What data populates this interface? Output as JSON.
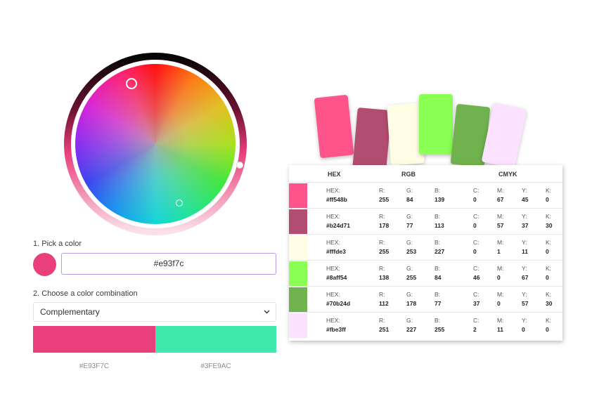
{
  "picker": {
    "step1_label": "1. Pick a color",
    "current_color": "#e93f7c",
    "hex_value": "#e93f7c",
    "step2_label": "2. Choose a color combination",
    "combination": "Complementary",
    "combo_colors": [
      "#E93F7C",
      "#3FE9AC"
    ],
    "combo_labels": [
      "#E93F7C",
      "#3FE9AC"
    ]
  },
  "palette_cards": [
    "#ff548b",
    "#b24d71",
    "#fffde3",
    "#8aff54",
    "#70b24d",
    "#fbe3ff"
  ],
  "table": {
    "headers": {
      "hex": "HEX",
      "rgb": "RGB",
      "cmyk": "CMYK"
    },
    "keys": {
      "hex": "HEX:",
      "r": "R:",
      "g": "G:",
      "b": "B:",
      "c": "C:",
      "m": "M:",
      "y": "Y:",
      "k": "K:"
    },
    "rows": [
      {
        "color": "#ff548b",
        "hex": "#ff548b",
        "r": "255",
        "g": "84",
        "b": "139",
        "c": "0",
        "m": "67",
        "y": "45",
        "k": "0"
      },
      {
        "color": "#b24d71",
        "hex": "#b24d71",
        "r": "178",
        "g": "77",
        "b": "113",
        "c": "0",
        "m": "57",
        "y": "37",
        "k": "30"
      },
      {
        "color": "#fffde3",
        "hex": "#fffde3",
        "r": "255",
        "g": "253",
        "b": "227",
        "c": "0",
        "m": "1",
        "y": "11",
        "k": "0"
      },
      {
        "color": "#8aff54",
        "hex": "#8aff54",
        "r": "138",
        "g": "255",
        "b": "84",
        "c": "46",
        "m": "0",
        "y": "67",
        "k": "0"
      },
      {
        "color": "#70b24d",
        "hex": "#70b24d",
        "r": "112",
        "g": "178",
        "b": "77",
        "c": "37",
        "m": "0",
        "y": "57",
        "k": "30"
      },
      {
        "color": "#fbe3ff",
        "hex": "#fbe3ff",
        "r": "251",
        "g": "227",
        "b": "255",
        "c": "2",
        "m": "11",
        "y": "0",
        "k": "0"
      }
    ]
  }
}
